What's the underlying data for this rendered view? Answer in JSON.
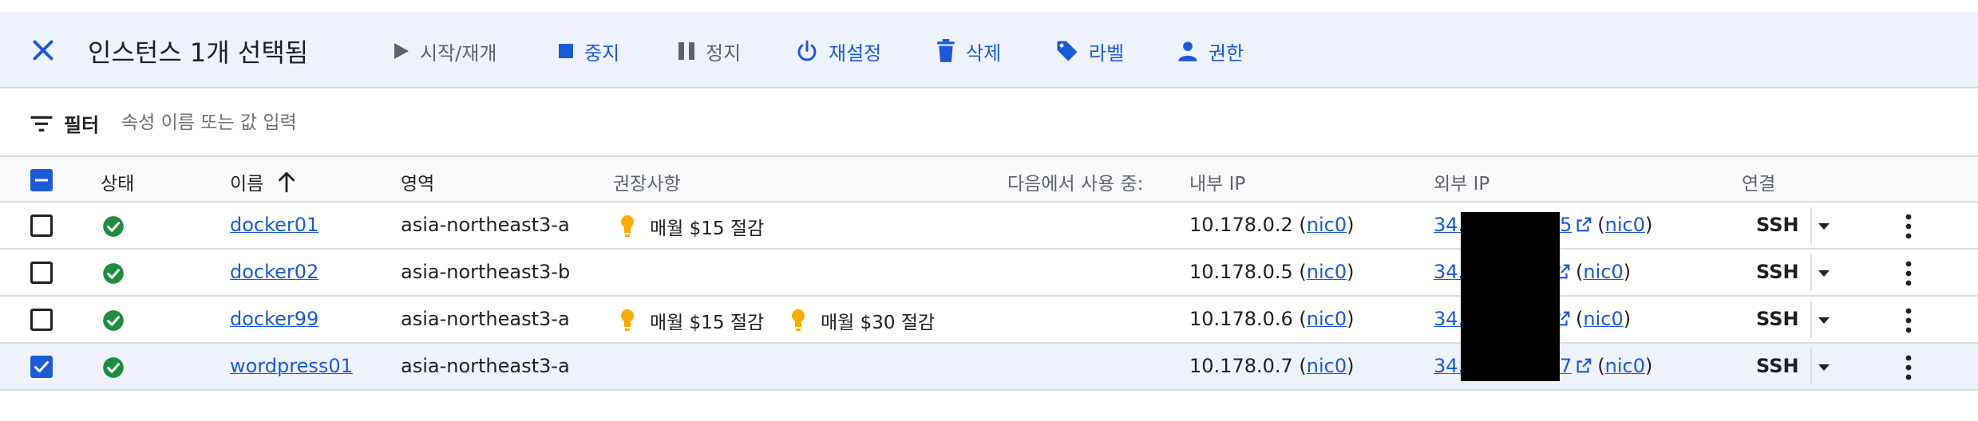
{
  "toolbar": {
    "title": "인스턴스 1개 선택됨",
    "buttons": {
      "start": "시작/재개",
      "stop": "중지",
      "suspend": "정지",
      "reset": "재설정",
      "delete": "삭제",
      "labels": "라벨",
      "permissions": "권한"
    }
  },
  "filter": {
    "label": "필터",
    "placeholder": "속성 이름 또는 값 입력"
  },
  "columns": {
    "status": "상태",
    "name": "이름",
    "zone": "영역",
    "recommendations": "권장사항",
    "in_use_by": "다음에서 사용 중:",
    "internal_ip": "내부 IP",
    "external_ip": "외부 IP",
    "connect": "연결"
  },
  "rows": [
    {
      "name": "docker01",
      "zone": "asia-northeast3-a",
      "recommendations": [
        "매월 $15 절감"
      ],
      "internal_ip": "10.178.0.2",
      "internal_nic": "nic0",
      "external_ip_start": "34.",
      "external_ip_end": "5",
      "external_nic": "nic0",
      "connect": "SSH",
      "checked": false
    },
    {
      "name": "docker02",
      "zone": "asia-northeast3-b",
      "recommendations": [],
      "internal_ip": "10.178.0.5",
      "internal_nic": "nic0",
      "external_ip_start": "34.",
      "external_ip_end": "",
      "external_nic": "nic0",
      "connect": "SSH",
      "checked": false
    },
    {
      "name": "docker99",
      "zone": "asia-northeast3-a",
      "recommendations": [
        "매월 $15 절감",
        "매월 $30 절감"
      ],
      "internal_ip": "10.178.0.6",
      "internal_nic": "nic0",
      "external_ip_start": "34.",
      "external_ip_end": "",
      "external_nic": "nic0",
      "connect": "SSH",
      "checked": false
    },
    {
      "name": "wordpress01",
      "zone": "asia-northeast3-a",
      "recommendations": [],
      "internal_ip": "10.178.0.7",
      "internal_nic": "nic0",
      "external_ip_start": "34.",
      "external_ip_end": "7",
      "external_nic": "nic0",
      "connect": "SSH",
      "checked": true
    }
  ],
  "colors": {
    "accent": "#1a5ad7",
    "status_ok": "#1e8e3e",
    "bulb": "#f9ab00",
    "selected_bg": "#edf2fc"
  },
  "icons": {
    "close": "close-icon",
    "status": "check-circle-icon",
    "recommendation": "lightbulb-icon",
    "sort": "arrow-up-icon",
    "external_link": "open-in-new-icon",
    "menu": "more-vert-icon"
  }
}
